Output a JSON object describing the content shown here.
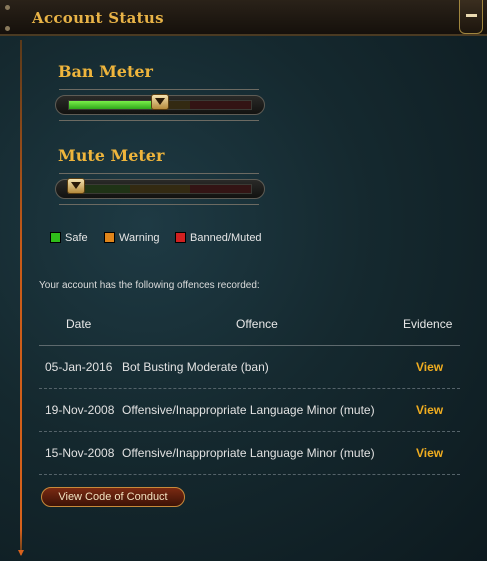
{
  "header": {
    "title": "Account Status"
  },
  "ban_meter": {
    "title": "Ban Meter",
    "level": 0.5
  },
  "mute_meter": {
    "title": "Mute Meter",
    "level": 0.04
  },
  "legend": [
    {
      "label": "Safe",
      "color": "#2fbd1a"
    },
    {
      "label": "Warning",
      "color": "#e0851a"
    },
    {
      "label": "Banned/Muted",
      "color": "#d12020"
    }
  ],
  "intro_text": "Your account has the following offences recorded:",
  "table": {
    "headers": {
      "date": "Date",
      "offence": "Offence",
      "evidence": "Evidence"
    },
    "rows": [
      {
        "date": "05-Jan-2016",
        "offence": "Bot Busting Moderate (ban)",
        "evidence": "View"
      },
      {
        "date": "19-Nov-2008",
        "offence": "Offensive/Inappropriate Language Minor (mute)",
        "evidence": "View"
      },
      {
        "date": "15-Nov-2008",
        "offence": "Offensive/Inappropriate Language Minor (mute)",
        "evidence": "View"
      }
    ]
  },
  "code_of_conduct_button": "View Code of Conduct"
}
